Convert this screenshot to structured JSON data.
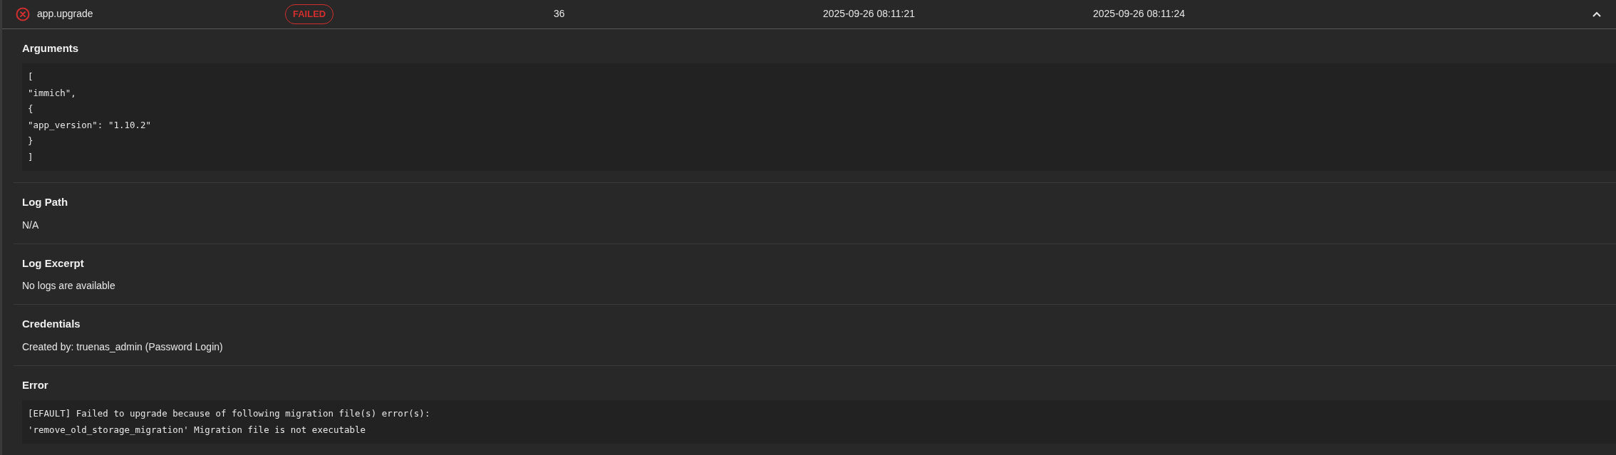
{
  "job": {
    "name": "app.upgrade",
    "failed": true,
    "badge": "FAILED",
    "column_3": "36",
    "column_4": "2025-09-26 08:11:21",
    "column_5": "2025-09-26 08:11:24",
    "expanded": true
  },
  "sections": [
    {
      "kind": "code",
      "title": "Arguments",
      "lines": [
        "[",
        "\"immich\",",
        "{",
        "\"app_version\": \"1.10.2\"",
        "}",
        "]"
      ]
    },
    {
      "kind": "text",
      "title": "Log Path",
      "text": "N/A"
    },
    {
      "kind": "text",
      "title": "Log Excerpt",
      "text": "No logs are available"
    },
    {
      "kind": "text",
      "title": "Credentials",
      "text": "Created by: truenas_admin (Password Login)"
    },
    {
      "kind": "code",
      "title": "Error",
      "lines": [
        "[EFAULT] Failed to upgrade because of following migration file(s) error(s):",
        "'remove_old_storage_migration' Migration file is not executable"
      ]
    }
  ]
}
